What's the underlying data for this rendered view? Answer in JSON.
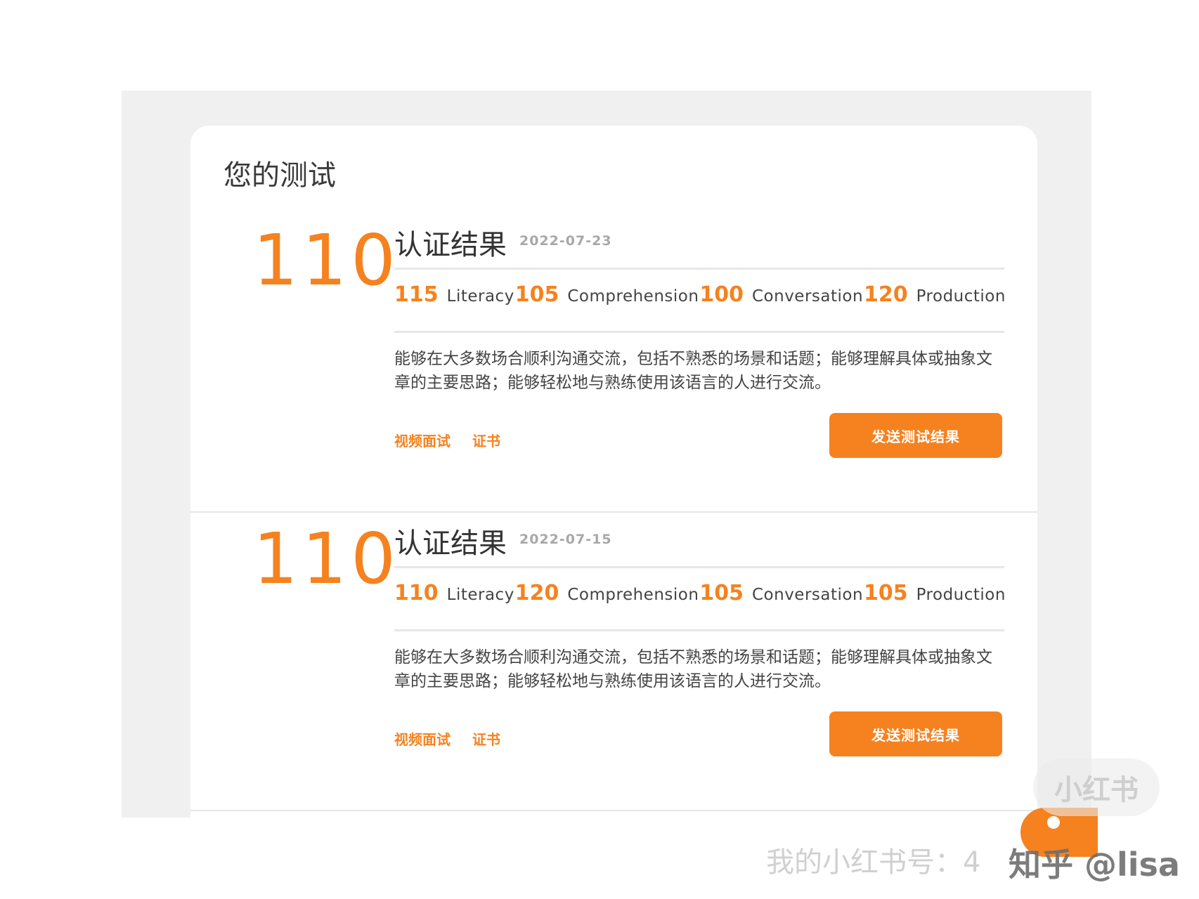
{
  "section_title": "您的测试",
  "results": [
    {
      "score": "110",
      "title": "认证结果",
      "date": "2022-07-23",
      "subscores": [
        {
          "value": "115",
          "label": "Literacy"
        },
        {
          "value": "105",
          "label": "Comprehension"
        },
        {
          "value": "100",
          "label": "Conversation"
        },
        {
          "value": "120",
          "label": "Production"
        }
      ],
      "description": "能够在大多数场合顺利沟通交流，包括不熟悉的场景和话题；能够理解具体或抽象文章的主要思路；能够轻松地与熟练使用该语言的人进行交流。",
      "link_video": "视频面试",
      "link_certificate": "证书",
      "send_button": "发送测试结果"
    },
    {
      "score": "110",
      "title": "认证结果",
      "date": "2022-07-15",
      "subscores": [
        {
          "value": "110",
          "label": "Literacy"
        },
        {
          "value": "120",
          "label": "Comprehension"
        },
        {
          "value": "105",
          "label": "Conversation"
        },
        {
          "value": "105",
          "label": "Production"
        }
      ],
      "description": "能够在大多数场合顺利沟通交流，包括不熟悉的场景和话题；能够理解具体或抽象文章的主要思路；能够轻松地与熟练使用该语言的人进行交流。",
      "link_video": "视频面试",
      "link_certificate": "证书",
      "send_button": "发送测试结果"
    }
  ],
  "watermark": {
    "badge": "小红书",
    "account_text": "我的小红书号：4",
    "zhihu_text": "知乎 @lisa"
  },
  "colors": {
    "accent": "#f5821f",
    "panel_bg": "#f0f0f0",
    "card_bg": "#ffffff"
  }
}
